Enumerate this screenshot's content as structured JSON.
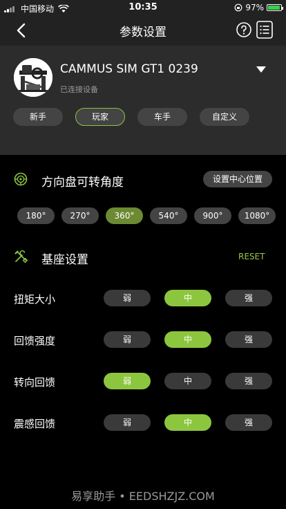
{
  "status_bar": {
    "carrier": "中国移动",
    "time": "10:35",
    "battery_percent": "97%",
    "battery_level": 0.97
  },
  "nav": {
    "title": "参数设置"
  },
  "device": {
    "name": "CAMMUS SIM GT1 0239",
    "status": "已连接设备"
  },
  "modes": {
    "items": [
      "新手",
      "玩家",
      "车手",
      "自定义"
    ],
    "selected": "玩家"
  },
  "steering": {
    "title": "方向盘可转角度",
    "center_button": "设置中心位置",
    "angles": [
      "180°",
      "270°",
      "360°",
      "540°",
      "900°",
      "1080°"
    ],
    "selected": "360°"
  },
  "base": {
    "title": "基座设置",
    "reset_label": "RESET",
    "rows": [
      {
        "label": "扭矩大小",
        "options": [
          "弱",
          "中",
          "强"
        ],
        "selected": "中"
      },
      {
        "label": "回馈强度",
        "options": [
          "弱",
          "中",
          "强"
        ],
        "selected": "中"
      },
      {
        "label": "转向回馈",
        "options": [
          "弱",
          "中",
          "强"
        ],
        "selected": "弱"
      },
      {
        "label": "震感回馈",
        "options": [
          "弱",
          "中",
          "强"
        ],
        "selected": "中"
      }
    ]
  },
  "watermark": "易享助手 • EEDSHZJZ.COM",
  "colors": {
    "accent": "#8cc63f",
    "accent_dark": "#6b8a32",
    "panel": "#2c2c2c",
    "background": "#000000"
  }
}
